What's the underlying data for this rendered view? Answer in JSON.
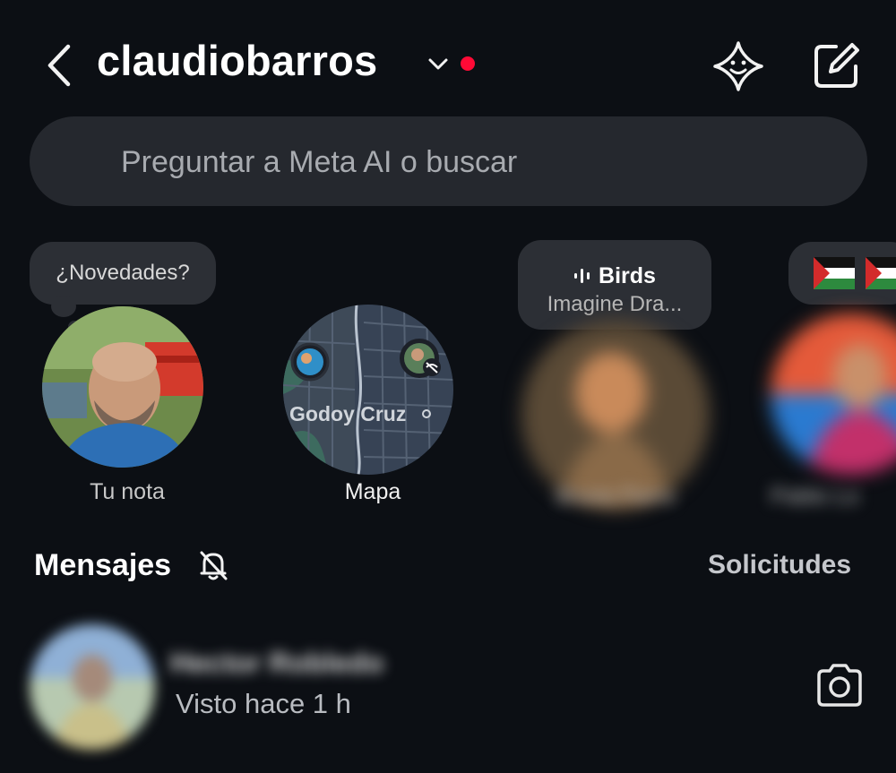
{
  "header": {
    "username": "claudiobarros",
    "back_icon": "chevron-left-icon",
    "account_switch_icon": "chevron-down-icon",
    "notification_dot_color": "#ff0a36",
    "meta_ai_icon": "meta-ai-sparkle-icon",
    "compose_icon": "compose-icon"
  },
  "search": {
    "placeholder": "Preguntar a Meta AI o buscar"
  },
  "notes": {
    "user_note_prompt": "¿Novedades?",
    "user_label": "Tu nota",
    "map_overlay_text": "Godoy Cruz",
    "map_label": "Mapa",
    "friend1_note_title": "Birds",
    "friend1_note_subtitle": "Imagine Dra...",
    "friend1_label": "Bruno Ferro",
    "friend2_label": "Pablo Lo"
  },
  "messages": {
    "title": "Mensajes",
    "requests_label": "Solicitudes",
    "conversations": [
      {
        "name": "Hector Robledo",
        "status": "Visto hace 1 h"
      }
    ]
  }
}
